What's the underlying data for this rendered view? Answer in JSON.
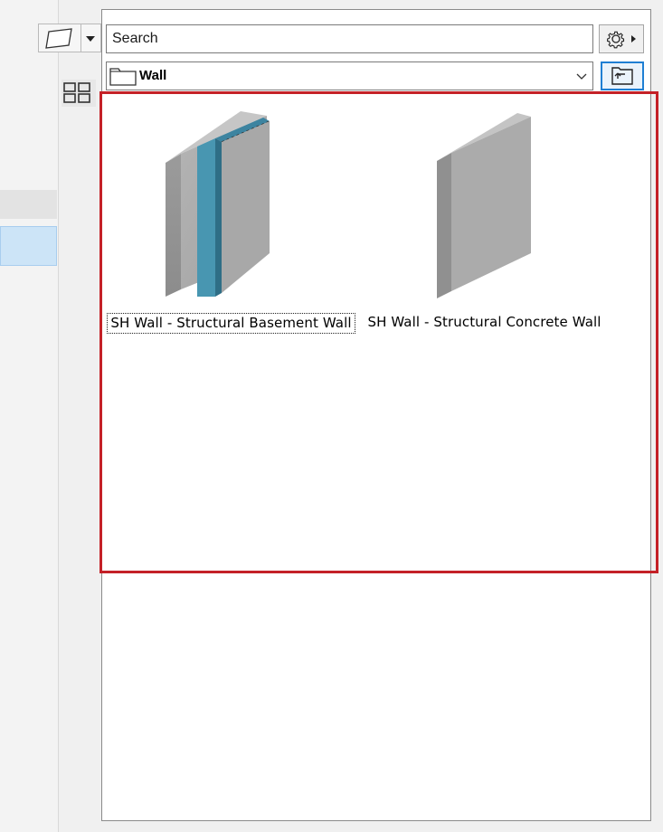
{
  "search": {
    "placeholder": "Search",
    "value": ""
  },
  "folder": {
    "selected": "Wall"
  },
  "items": [
    {
      "label": "SH Wall - Structural Basement Wall",
      "selected": true
    },
    {
      "label": "SH Wall - Structural Concrete Wall",
      "selected": false
    }
  ],
  "colors": {
    "highlight": "#c42127",
    "insulation_layer": "#4896b1",
    "concrete": "#a9a9a9",
    "selection_blue": "#cce4f7"
  },
  "icons": [
    "wall-shape-icon",
    "chevron-down-icon",
    "grid-view-icon",
    "gear-icon",
    "folder-icon",
    "up-folder-icon"
  ]
}
